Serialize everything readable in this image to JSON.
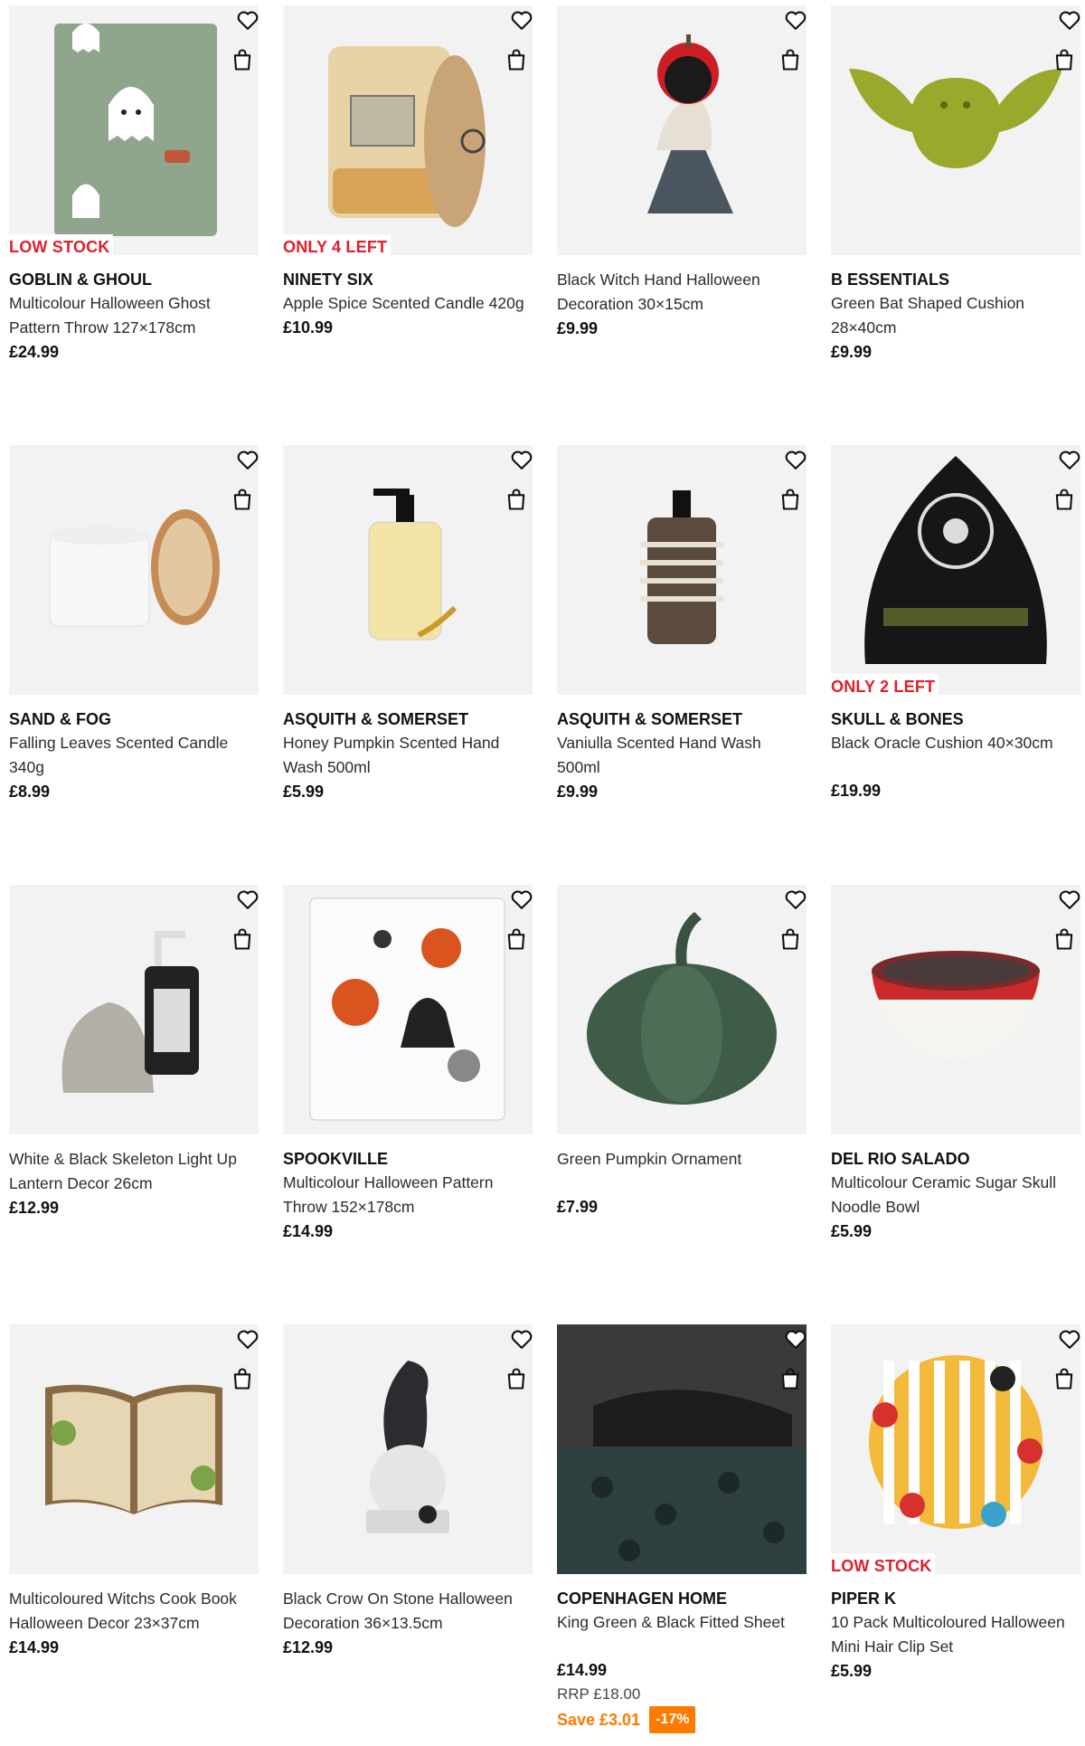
{
  "icons": {
    "favourite": "heart-outline-icon",
    "basket": "shopping-bag-icon"
  },
  "colors": {
    "badge": "#e0202b",
    "saving": "#ff7a00",
    "text": "#1a1a1a"
  },
  "products": [
    {
      "badge": "LOW STOCK",
      "brand": "GOBLIN & GHOUL",
      "title": "Multicolour Halloween Ghost Pattern Throw 127×178cm",
      "price": "£24.99"
    },
    {
      "badge": "ONLY 4 LEFT",
      "brand": "NINETY SIX",
      "title": "Apple Spice Scented Candle 420g",
      "price": "£10.99"
    },
    {
      "title": "Black Witch Hand Halloween Decoration 30×15cm",
      "price": "£9.99"
    },
    {
      "brand": "B ESSENTIALS",
      "title": "Green Bat Shaped Cushion 28×40cm",
      "price": "£9.99"
    },
    {
      "brand": "SAND & FOG",
      "title": "Falling Leaves Scented Candle 340g",
      "price": "£8.99"
    },
    {
      "brand": "ASQUITH & SOMERSET",
      "title": "Honey Pumpkin Scented Hand Wash 500ml",
      "price": "£5.99"
    },
    {
      "brand": "ASQUITH & SOMERSET",
      "title": "Vaniulla Scented Hand Wash 500ml",
      "price": "£9.99"
    },
    {
      "badge": "ONLY 2 LEFT",
      "brand": "SKULL & BONES",
      "title": "Black Oracle Cushion 40×30cm",
      "price": "£19.99"
    },
    {
      "title": "White & Black Skeleton Light Up Lantern Decor 26cm",
      "price": "£12.99"
    },
    {
      "brand": "SPOOKVILLE",
      "title": "Multicolour Halloween Pattern Throw 152×178cm",
      "price": "£14.99"
    },
    {
      "title": "Green Pumpkin Ornament",
      "price": "£7.99"
    },
    {
      "brand": "DEL RIO SALADO",
      "title": "Multicolour Ceramic Sugar Skull Noodle Bowl",
      "price": "£5.99"
    },
    {
      "title": "Multicoloured Witchs Cook Book Halloween Decor 23×37cm",
      "price": "£14.99"
    },
    {
      "title": "Black Crow On Stone Halloween Decoration 36×13.5cm",
      "price": "£12.99"
    },
    {
      "brand": "COPENHAGEN HOME",
      "title": "King Green & Black Fitted Sheet",
      "price": "£14.99",
      "rrp": "RRP £18.00",
      "save": "Save £3.01",
      "discount": "-17%"
    },
    {
      "badge": "LOW STOCK",
      "brand": "PIPER K",
      "title": "10 Pack Multicoloured Halloween Mini Hair Clip Set",
      "price": "£5.99"
    }
  ]
}
